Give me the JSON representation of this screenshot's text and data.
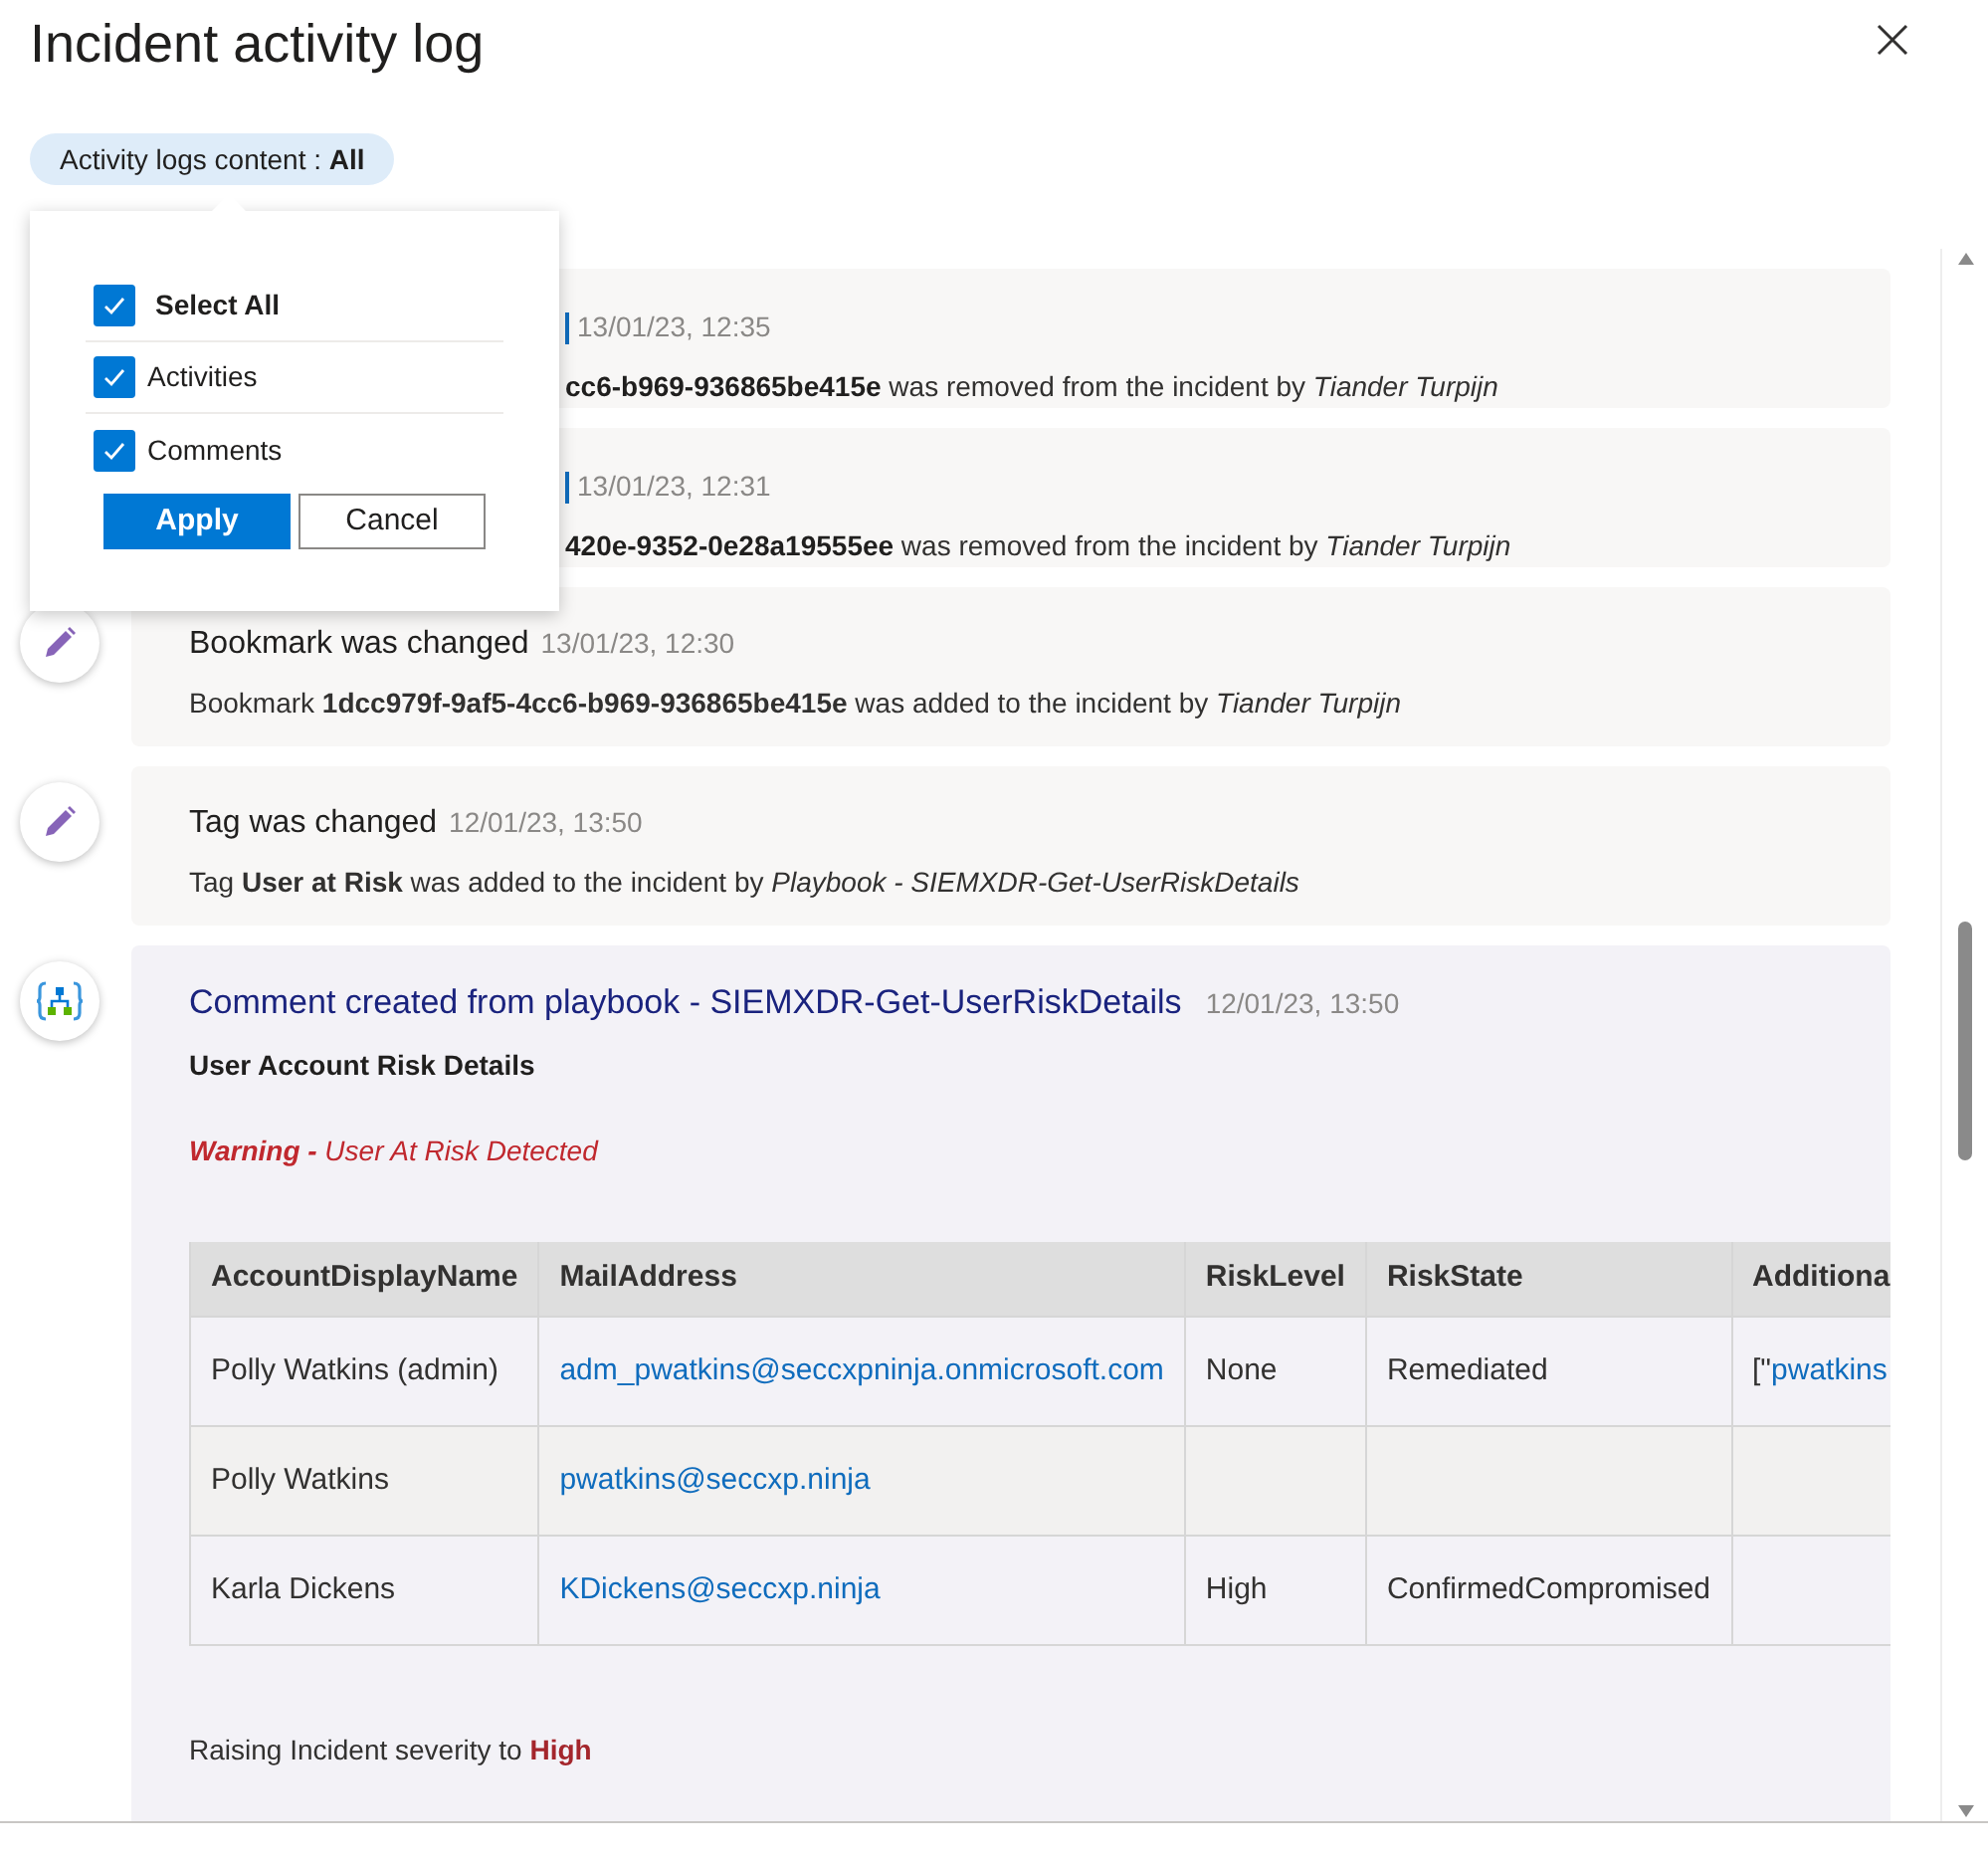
{
  "title": "Incident activity log",
  "filter": {
    "label": "Activity logs content : ",
    "value": "All"
  },
  "popover": {
    "options": [
      {
        "label": "Select All",
        "checked": true,
        "kind": "all"
      },
      {
        "label": "Activities",
        "checked": true,
        "kind": "item"
      },
      {
        "label": "Comments",
        "checked": true,
        "kind": "item"
      }
    ],
    "buttons": [
      {
        "label": "Apply",
        "kind": "primary"
      },
      {
        "label": "Cancel",
        "kind": "secondary"
      }
    ]
  },
  "entries": [
    {
      "kind": "hidden"
    },
    {
      "kind": "covered",
      "time": "13/01/23, 12:35",
      "body": "**cc6-b969-936865be415e** was removed from the incident by *Tiander Turpijn*"
    },
    {
      "kind": "covered",
      "time": "13/01/23, 12:31",
      "body": "**420e-9352-0e28a19555ee** was removed from the incident by *Tiander Turpijn*"
    },
    {
      "kind": "activity",
      "title": "Bookmark was changed",
      "time": "13/01/23, 12:30",
      "body": "Bookmark **1dcc979f-9af5-4cc6-b969-936865be415e** was added to the incident by *Tiander Turpijn*"
    },
    {
      "kind": "activity",
      "title": "Tag was changed",
      "time": "12/01/23, 13:50",
      "body": "Tag **User at Risk** was added to the incident by *Playbook - SIEMXDR-Get-UserRiskDetails*"
    },
    {
      "kind": "comment",
      "title": "Comment created from playbook - SIEMXDR-Get-UserRiskDetails",
      "time": "12/01/23, 13:50",
      "heading": "User Account Risk Details",
      "warning": "**Warning -** User At Risk Detected",
      "table": {
        "columns": [
          "AccountDisplayName",
          "MailAddress",
          "RiskLevel",
          "RiskState",
          "Additiona"
        ],
        "rows": [
          [
            {
              "text": "Polly Watkins (admin)"
            },
            {
              "link": "adm_pwatkins@seccxpninja.onmicrosoft.com"
            },
            {
              "text": "None"
            },
            {
              "text": "Remediated"
            },
            {
              "text": "[\"",
              "link": "pwatkins"
            }
          ],
          [
            {
              "text": "Polly Watkins"
            },
            {
              "link": "pwatkins@seccxp.ninja"
            },
            {},
            {},
            {}
          ],
          [
            {
              "text": "Karla Dickens"
            },
            {
              "link": "KDickens@seccxp.ninja"
            },
            {
              "text": "High"
            },
            {
              "text": "ConfirmedCompromised"
            },
            {}
          ]
        ]
      },
      "footer": "Raising Incident severity to **High**"
    }
  ]
}
